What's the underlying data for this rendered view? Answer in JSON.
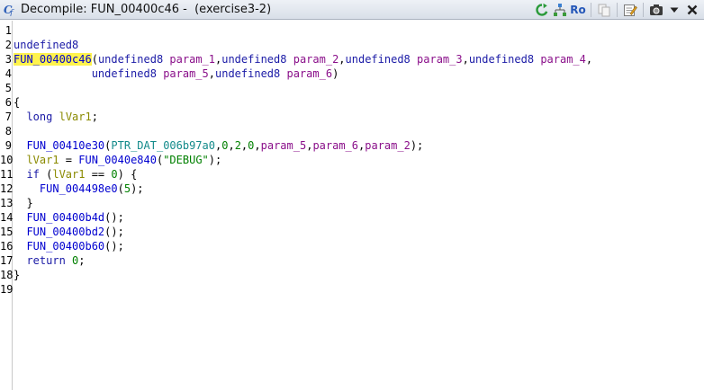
{
  "window": {
    "title": "Decompile: FUN_00400c46 -  (exercise3-2)"
  },
  "toolbar": {
    "ro_label": "Ro",
    "icons": [
      "refresh-icon",
      "function-graph-icon",
      "ro-toggle",
      "copy-icon",
      "edit-icon",
      "snapshot-icon",
      "menu-dropdown-icon",
      "close-icon"
    ]
  },
  "code": {
    "line_numbers": [
      "1",
      "2",
      "3",
      "4",
      "5",
      "6",
      "7",
      "8",
      "9",
      "10",
      "11",
      "12",
      "13",
      "14",
      "15",
      "16",
      "17",
      "18",
      "19"
    ],
    "lines": [
      [],
      [
        {
          "t": "undefined8",
          "c": "type"
        }
      ],
      [
        {
          "t": "FUN_00400c46",
          "c": "func hl"
        },
        {
          "t": "(",
          "c": ""
        },
        {
          "t": "undefined8",
          "c": "type"
        },
        {
          "t": " ",
          "c": ""
        },
        {
          "t": "param_1",
          "c": "param"
        },
        {
          "t": ",",
          "c": ""
        },
        {
          "t": "undefined8",
          "c": "type"
        },
        {
          "t": " ",
          "c": ""
        },
        {
          "t": "param_2",
          "c": "param"
        },
        {
          "t": ",",
          "c": ""
        },
        {
          "t": "undefined8",
          "c": "type"
        },
        {
          "t": " ",
          "c": ""
        },
        {
          "t": "param_3",
          "c": "param"
        },
        {
          "t": ",",
          "c": ""
        },
        {
          "t": "undefined8",
          "c": "type"
        },
        {
          "t": " ",
          "c": ""
        },
        {
          "t": "param_4",
          "c": "param"
        },
        {
          "t": ",",
          "c": ""
        }
      ],
      [
        {
          "t": "            ",
          "c": ""
        },
        {
          "t": "undefined8",
          "c": "type"
        },
        {
          "t": " ",
          "c": ""
        },
        {
          "t": "param_5",
          "c": "param"
        },
        {
          "t": ",",
          "c": ""
        },
        {
          "t": "undefined8",
          "c": "type"
        },
        {
          "t": " ",
          "c": ""
        },
        {
          "t": "param_6",
          "c": "param"
        },
        {
          "t": ")",
          "c": ""
        }
      ],
      [],
      [
        {
          "t": "{",
          "c": ""
        }
      ],
      [
        {
          "t": "  ",
          "c": ""
        },
        {
          "t": "long",
          "c": "type"
        },
        {
          "t": " ",
          "c": ""
        },
        {
          "t": "lVar1",
          "c": "var"
        },
        {
          "t": ";",
          "c": ""
        }
      ],
      [],
      [
        {
          "t": "  ",
          "c": ""
        },
        {
          "t": "FUN_00410e30",
          "c": "func"
        },
        {
          "t": "(",
          "c": ""
        },
        {
          "t": "PTR_DAT_006b97a0",
          "c": "global"
        },
        {
          "t": ",",
          "c": ""
        },
        {
          "t": "0",
          "c": "const"
        },
        {
          "t": ",",
          "c": ""
        },
        {
          "t": "2",
          "c": "const"
        },
        {
          "t": ",",
          "c": ""
        },
        {
          "t": "0",
          "c": "const"
        },
        {
          "t": ",",
          "c": ""
        },
        {
          "t": "param_5",
          "c": "param"
        },
        {
          "t": ",",
          "c": ""
        },
        {
          "t": "param_6",
          "c": "param"
        },
        {
          "t": ",",
          "c": ""
        },
        {
          "t": "param_2",
          "c": "param"
        },
        {
          "t": ");",
          "c": ""
        }
      ],
      [
        {
          "t": "  ",
          "c": ""
        },
        {
          "t": "lVar1",
          "c": "var"
        },
        {
          "t": " = ",
          "c": ""
        },
        {
          "t": "FUN_0040e840",
          "c": "func"
        },
        {
          "t": "(",
          "c": ""
        },
        {
          "t": "\"DEBUG\"",
          "c": "str"
        },
        {
          "t": ");",
          "c": ""
        }
      ],
      [
        {
          "t": "  ",
          "c": ""
        },
        {
          "t": "if",
          "c": "kw"
        },
        {
          "t": " (",
          "c": ""
        },
        {
          "t": "lVar1",
          "c": "var"
        },
        {
          "t": " == ",
          "c": ""
        },
        {
          "t": "0",
          "c": "const"
        },
        {
          "t": ") {",
          "c": ""
        }
      ],
      [
        {
          "t": "    ",
          "c": ""
        },
        {
          "t": "FUN_004498e0",
          "c": "func"
        },
        {
          "t": "(",
          "c": ""
        },
        {
          "t": "5",
          "c": "const"
        },
        {
          "t": ");",
          "c": ""
        }
      ],
      [
        {
          "t": "  }",
          "c": ""
        }
      ],
      [
        {
          "t": "  ",
          "c": ""
        },
        {
          "t": "FUN_00400b4d",
          "c": "func"
        },
        {
          "t": "();",
          "c": ""
        }
      ],
      [
        {
          "t": "  ",
          "c": ""
        },
        {
          "t": "FUN_00400bd2",
          "c": "func"
        },
        {
          "t": "();",
          "c": ""
        }
      ],
      [
        {
          "t": "  ",
          "c": ""
        },
        {
          "t": "FUN_00400b60",
          "c": "func"
        },
        {
          "t": "();",
          "c": ""
        }
      ],
      [
        {
          "t": "  ",
          "c": ""
        },
        {
          "t": "return",
          "c": "kw"
        },
        {
          "t": " ",
          "c": ""
        },
        {
          "t": "0",
          "c": "const"
        },
        {
          "t": ";",
          "c": ""
        }
      ],
      [
        {
          "t": "}",
          "c": ""
        }
      ],
      []
    ]
  }
}
